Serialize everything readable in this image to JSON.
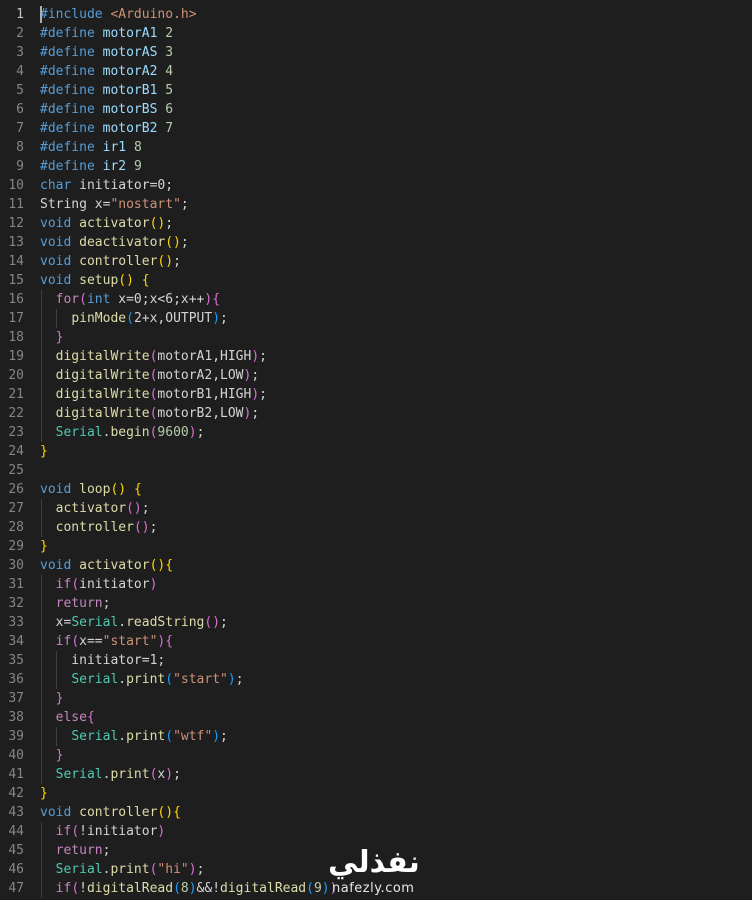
{
  "editor": {
    "lines": [
      {
        "n": "1",
        "tokens": [
          [
            "mac",
            "#include"
          ],
          [
            "txt",
            " "
          ],
          [
            "str",
            "<Arduino.h>"
          ]
        ]
      },
      {
        "n": "2",
        "tokens": [
          [
            "mac",
            "#define"
          ],
          [
            "txt",
            " "
          ],
          [
            "var",
            "motorA1"
          ],
          [
            "txt",
            " "
          ],
          [
            "num",
            "2"
          ]
        ]
      },
      {
        "n": "3",
        "tokens": [
          [
            "mac",
            "#define"
          ],
          [
            "txt",
            " "
          ],
          [
            "var",
            "motorAS"
          ],
          [
            "txt",
            " "
          ],
          [
            "num",
            "3"
          ]
        ]
      },
      {
        "n": "4",
        "tokens": [
          [
            "mac",
            "#define"
          ],
          [
            "txt",
            " "
          ],
          [
            "var",
            "motorA2"
          ],
          [
            "txt",
            " "
          ],
          [
            "num",
            "4"
          ]
        ]
      },
      {
        "n": "5",
        "tokens": [
          [
            "mac",
            "#define"
          ],
          [
            "txt",
            " "
          ],
          [
            "var",
            "motorB1"
          ],
          [
            "txt",
            " "
          ],
          [
            "num",
            "5"
          ]
        ]
      },
      {
        "n": "6",
        "tokens": [
          [
            "mac",
            "#define"
          ],
          [
            "txt",
            " "
          ],
          [
            "var",
            "motorBS"
          ],
          [
            "txt",
            " "
          ],
          [
            "num",
            "6"
          ]
        ]
      },
      {
        "n": "7",
        "tokens": [
          [
            "mac",
            "#define"
          ],
          [
            "txt",
            " "
          ],
          [
            "var",
            "motorB2"
          ],
          [
            "txt",
            " "
          ],
          [
            "num",
            "7"
          ]
        ]
      },
      {
        "n": "8",
        "tokens": [
          [
            "mac",
            "#define"
          ],
          [
            "txt",
            " "
          ],
          [
            "var",
            "ir1"
          ],
          [
            "txt",
            " "
          ],
          [
            "num",
            "8"
          ]
        ]
      },
      {
        "n": "9",
        "tokens": [
          [
            "mac",
            "#define"
          ],
          [
            "txt",
            " "
          ],
          [
            "var",
            "ir2"
          ],
          [
            "txt",
            " "
          ],
          [
            "num",
            "9"
          ]
        ]
      },
      {
        "n": "10",
        "tokens": [
          [
            "kw",
            "char"
          ],
          [
            "txt",
            " initiator=0;"
          ]
        ]
      },
      {
        "n": "11",
        "tokens": [
          [
            "txt",
            "String x="
          ],
          [
            "str",
            "\"nostart\""
          ],
          [
            "txt",
            ";"
          ]
        ]
      },
      {
        "n": "12",
        "tokens": [
          [
            "kw",
            "void"
          ],
          [
            "txt",
            " "
          ],
          [
            "fn",
            "activator"
          ],
          [
            "p1",
            "()"
          ],
          [
            "txt",
            ";"
          ]
        ]
      },
      {
        "n": "13",
        "tokens": [
          [
            "kw",
            "void"
          ],
          [
            "txt",
            " "
          ],
          [
            "fn",
            "deactivator"
          ],
          [
            "p1",
            "()"
          ],
          [
            "txt",
            ";"
          ]
        ]
      },
      {
        "n": "14",
        "tokens": [
          [
            "kw",
            "void"
          ],
          [
            "txt",
            " "
          ],
          [
            "fn",
            "controller"
          ],
          [
            "p1",
            "()"
          ],
          [
            "txt",
            ";"
          ]
        ]
      },
      {
        "n": "15",
        "tokens": [
          [
            "kw",
            "void"
          ],
          [
            "txt",
            " "
          ],
          [
            "fn",
            "setup"
          ],
          [
            "p1",
            "()"
          ],
          [
            "txt",
            " "
          ],
          [
            "p1",
            "{"
          ]
        ]
      },
      {
        "n": "16",
        "tokens": [
          [
            "txt",
            "  "
          ],
          [
            "ctl",
            "for"
          ],
          [
            "p2",
            "("
          ],
          [
            "kw",
            "int"
          ],
          [
            "txt",
            " x=0;x<6;x++"
          ],
          [
            "p2",
            ")"
          ],
          [
            "p2",
            "{"
          ]
        ]
      },
      {
        "n": "17",
        "tokens": [
          [
            "txt",
            "    "
          ],
          [
            "fn",
            "pinMode"
          ],
          [
            "p3",
            "("
          ],
          [
            "txt",
            "2+x,OUTPUT"
          ],
          [
            "p3",
            ")"
          ],
          [
            "txt",
            ";"
          ]
        ]
      },
      {
        "n": "18",
        "tokens": [
          [
            "txt",
            "  "
          ],
          [
            "p2",
            "}"
          ]
        ]
      },
      {
        "n": "19",
        "tokens": [
          [
            "txt",
            "  "
          ],
          [
            "fn",
            "digitalWrite"
          ],
          [
            "p2",
            "("
          ],
          [
            "txt",
            "motorA1,HIGH"
          ],
          [
            "p2",
            ")"
          ],
          [
            "txt",
            ";"
          ]
        ]
      },
      {
        "n": "20",
        "tokens": [
          [
            "txt",
            "  "
          ],
          [
            "fn",
            "digitalWrite"
          ],
          [
            "p2",
            "("
          ],
          [
            "txt",
            "motorA2,LOW"
          ],
          [
            "p2",
            ")"
          ],
          [
            "txt",
            ";"
          ]
        ]
      },
      {
        "n": "21",
        "tokens": [
          [
            "txt",
            "  "
          ],
          [
            "fn",
            "digitalWrite"
          ],
          [
            "p2",
            "("
          ],
          [
            "txt",
            "motorB1,HIGH"
          ],
          [
            "p2",
            ")"
          ],
          [
            "txt",
            ";"
          ]
        ]
      },
      {
        "n": "22",
        "tokens": [
          [
            "txt",
            "  "
          ],
          [
            "fn",
            "digitalWrite"
          ],
          [
            "p2",
            "("
          ],
          [
            "txt",
            "motorB2,LOW"
          ],
          [
            "p2",
            ")"
          ],
          [
            "txt",
            ";"
          ]
        ]
      },
      {
        "n": "23",
        "tokens": [
          [
            "txt",
            "  "
          ],
          [
            "cls",
            "Serial"
          ],
          [
            "txt",
            "."
          ],
          [
            "fn",
            "begin"
          ],
          [
            "p2",
            "("
          ],
          [
            "num",
            "9600"
          ],
          [
            "p2",
            ")"
          ],
          [
            "txt",
            ";"
          ]
        ]
      },
      {
        "n": "24",
        "tokens": [
          [
            "p1",
            "}"
          ]
        ]
      },
      {
        "n": "25",
        "tokens": []
      },
      {
        "n": "26",
        "tokens": [
          [
            "kw",
            "void"
          ],
          [
            "txt",
            " "
          ],
          [
            "fn",
            "loop"
          ],
          [
            "p1",
            "()"
          ],
          [
            "txt",
            " "
          ],
          [
            "p1",
            "{"
          ]
        ]
      },
      {
        "n": "27",
        "tokens": [
          [
            "txt",
            "  "
          ],
          [
            "fn",
            "activator"
          ],
          [
            "p2",
            "()"
          ],
          [
            "txt",
            ";"
          ]
        ]
      },
      {
        "n": "28",
        "tokens": [
          [
            "txt",
            "  "
          ],
          [
            "fn",
            "controller"
          ],
          [
            "p2",
            "()"
          ],
          [
            "txt",
            ";"
          ]
        ]
      },
      {
        "n": "29",
        "tokens": [
          [
            "p1",
            "}"
          ]
        ]
      },
      {
        "n": "30",
        "tokens": [
          [
            "kw",
            "void"
          ],
          [
            "txt",
            " "
          ],
          [
            "fn",
            "activator"
          ],
          [
            "p1",
            "()"
          ],
          [
            "p1",
            "{"
          ]
        ]
      },
      {
        "n": "31",
        "tokens": [
          [
            "txt",
            "  "
          ],
          [
            "ctl",
            "if"
          ],
          [
            "p2",
            "("
          ],
          [
            "txt",
            "initiator"
          ],
          [
            "p2",
            ")"
          ]
        ]
      },
      {
        "n": "32",
        "tokens": [
          [
            "txt",
            "  "
          ],
          [
            "ctl",
            "return"
          ],
          [
            "txt",
            ";"
          ]
        ]
      },
      {
        "n": "33",
        "tokens": [
          [
            "txt",
            "  x="
          ],
          [
            "cls",
            "Serial"
          ],
          [
            "txt",
            "."
          ],
          [
            "fn",
            "readString"
          ],
          [
            "p2",
            "()"
          ],
          [
            "txt",
            ";"
          ]
        ]
      },
      {
        "n": "34",
        "tokens": [
          [
            "txt",
            "  "
          ],
          [
            "ctl",
            "if"
          ],
          [
            "p2",
            "("
          ],
          [
            "txt",
            "x=="
          ],
          [
            "str",
            "\"start\""
          ],
          [
            "p2",
            ")"
          ],
          [
            "p2",
            "{"
          ]
        ]
      },
      {
        "n": "35",
        "tokens": [
          [
            "txt",
            "    initiator=1;"
          ]
        ]
      },
      {
        "n": "36",
        "tokens": [
          [
            "txt",
            "    "
          ],
          [
            "cls",
            "Serial"
          ],
          [
            "txt",
            "."
          ],
          [
            "fn",
            "print"
          ],
          [
            "p3",
            "("
          ],
          [
            "str",
            "\"start\""
          ],
          [
            "p3",
            ")"
          ],
          [
            "txt",
            ";"
          ]
        ]
      },
      {
        "n": "37",
        "tokens": [
          [
            "txt",
            "  "
          ],
          [
            "p2",
            "}"
          ]
        ]
      },
      {
        "n": "38",
        "tokens": [
          [
            "txt",
            "  "
          ],
          [
            "ctl",
            "else"
          ],
          [
            "p2",
            "{"
          ]
        ]
      },
      {
        "n": "39",
        "tokens": [
          [
            "txt",
            "    "
          ],
          [
            "cls",
            "Serial"
          ],
          [
            "txt",
            "."
          ],
          [
            "fn",
            "print"
          ],
          [
            "p3",
            "("
          ],
          [
            "str",
            "\"wtf\""
          ],
          [
            "p3",
            ")"
          ],
          [
            "txt",
            ";"
          ]
        ]
      },
      {
        "n": "40",
        "tokens": [
          [
            "txt",
            "  "
          ],
          [
            "p2",
            "}"
          ]
        ]
      },
      {
        "n": "41",
        "tokens": [
          [
            "txt",
            "  "
          ],
          [
            "cls",
            "Serial"
          ],
          [
            "txt",
            "."
          ],
          [
            "fn",
            "print"
          ],
          [
            "p2",
            "("
          ],
          [
            "txt",
            "x"
          ],
          [
            "p2",
            ")"
          ],
          [
            "txt",
            ";"
          ]
        ]
      },
      {
        "n": "42",
        "tokens": [
          [
            "p1",
            "}"
          ]
        ]
      },
      {
        "n": "43",
        "tokens": [
          [
            "kw",
            "void"
          ],
          [
            "txt",
            " "
          ],
          [
            "fn",
            "controller"
          ],
          [
            "p1",
            "()"
          ],
          [
            "p1",
            "{"
          ]
        ]
      },
      {
        "n": "44",
        "tokens": [
          [
            "txt",
            "  "
          ],
          [
            "ctl",
            "if"
          ],
          [
            "p2",
            "("
          ],
          [
            "txt",
            "!initiator"
          ],
          [
            "p2",
            ")"
          ]
        ]
      },
      {
        "n": "45",
        "tokens": [
          [
            "txt",
            "  "
          ],
          [
            "ctl",
            "return"
          ],
          [
            "txt",
            ";"
          ]
        ]
      },
      {
        "n": "46",
        "tokens": [
          [
            "txt",
            "  "
          ],
          [
            "cls",
            "Serial"
          ],
          [
            "txt",
            "."
          ],
          [
            "fn",
            "print"
          ],
          [
            "p2",
            "("
          ],
          [
            "str",
            "\"hi\""
          ],
          [
            "p2",
            ")"
          ],
          [
            "txt",
            ";"
          ]
        ]
      },
      {
        "n": "47",
        "tokens": [
          [
            "txt",
            "  "
          ],
          [
            "ctl",
            "if"
          ],
          [
            "p2",
            "("
          ],
          [
            "txt",
            "!"
          ],
          [
            "fn",
            "digitalRead"
          ],
          [
            "p3",
            "("
          ],
          [
            "num",
            "8"
          ],
          [
            "p3",
            ")"
          ],
          [
            "txt",
            "&&!"
          ],
          [
            "fn",
            "digitalRead"
          ],
          [
            "p3",
            "("
          ],
          [
            "num",
            "9"
          ],
          [
            "p3",
            ")"
          ],
          [
            "p2",
            ")"
          ]
        ]
      }
    ],
    "active_line": "1"
  },
  "watermark": {
    "arabic": "نفذلي",
    "latin": "nafezly.com"
  },
  "colors": {
    "background": "#1e1e1e",
    "keyword": "#569cd6",
    "control": "#c586c0",
    "function": "#dcdcaa",
    "string": "#ce9178",
    "number": "#b5cea8",
    "class": "#4ec9b0"
  }
}
